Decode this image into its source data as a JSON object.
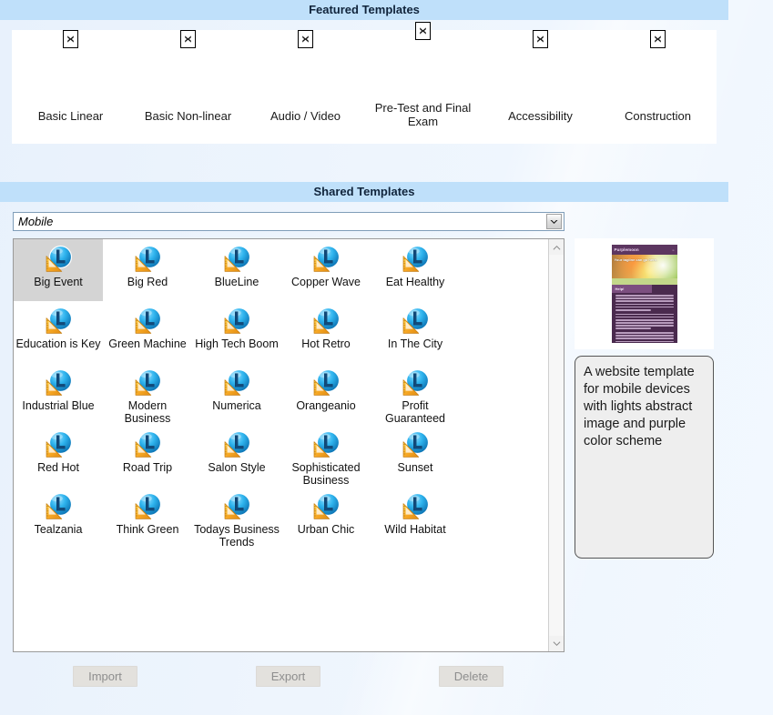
{
  "featured": {
    "title": "Featured Templates",
    "items": [
      {
        "label": "Basic Linear",
        "icon": "broken-image-icon"
      },
      {
        "label": "Basic Non-linear",
        "icon": "broken-image-icon"
      },
      {
        "label": "Audio / Video",
        "icon": "broken-image-icon"
      },
      {
        "label": "Pre-Test and Final Exam",
        "icon": "broken-image-icon"
      },
      {
        "label": "Accessibility",
        "icon": "broken-image-icon"
      },
      {
        "label": "Construction",
        "icon": "broken-image-icon"
      }
    ]
  },
  "shared": {
    "title": "Shared Templates",
    "category": {
      "value": "Mobile",
      "icon": "chevron-down-icon"
    },
    "templates": [
      {
        "label": "Big Event",
        "selected": true
      },
      {
        "label": "Big Red",
        "selected": false
      },
      {
        "label": "BlueLine",
        "selected": false
      },
      {
        "label": "Copper Wave",
        "selected": false
      },
      {
        "label": "Eat Healthy",
        "selected": false
      },
      {
        "label": "Education is Key",
        "selected": false
      },
      {
        "label": "Green Machine",
        "selected": false
      },
      {
        "label": "High Tech Boom",
        "selected": false
      },
      {
        "label": "Hot Retro",
        "selected": false
      },
      {
        "label": "In The City",
        "selected": false
      },
      {
        "label": "Industrial Blue",
        "selected": false
      },
      {
        "label": "Modern Business",
        "selected": false
      },
      {
        "label": "Numerica",
        "selected": false
      },
      {
        "label": "Orangeanio",
        "selected": false
      },
      {
        "label": "Profit Guaranteed",
        "selected": false
      },
      {
        "label": "Red Hot",
        "selected": false
      },
      {
        "label": "Road Trip",
        "selected": false
      },
      {
        "label": "Salon Style",
        "selected": false
      },
      {
        "label": "Sophisticated Business",
        "selected": false
      },
      {
        "label": "Sunset",
        "selected": false
      },
      {
        "label": "Tealzania",
        "selected": false
      },
      {
        "label": "Think Green",
        "selected": false
      },
      {
        "label": "Todays Business Trends",
        "selected": false
      },
      {
        "label": "Urban Chic",
        "selected": false
      },
      {
        "label": "Wild Habitat",
        "selected": false
      }
    ],
    "scrollbar": {
      "up_icon": "chevron-up-icon",
      "down_icon": "chevron-down-icon"
    }
  },
  "preview": {
    "thumbnail": {
      "title": "Purplemoon",
      "corner": "cart",
      "hero_text": "Your tagline can go here.",
      "help_label": "Help!"
    },
    "description": "A website template for mobile devices with lights abstract image and purple color scheme"
  },
  "actions": {
    "import": "Import",
    "export": "Export",
    "delete": "Delete"
  },
  "colors": {
    "section_bar": "#bfe0fa",
    "selected_item": "#d4d4d4",
    "page_background": "#eef5fd",
    "thumbnail_purple": "#4a2a4e"
  }
}
